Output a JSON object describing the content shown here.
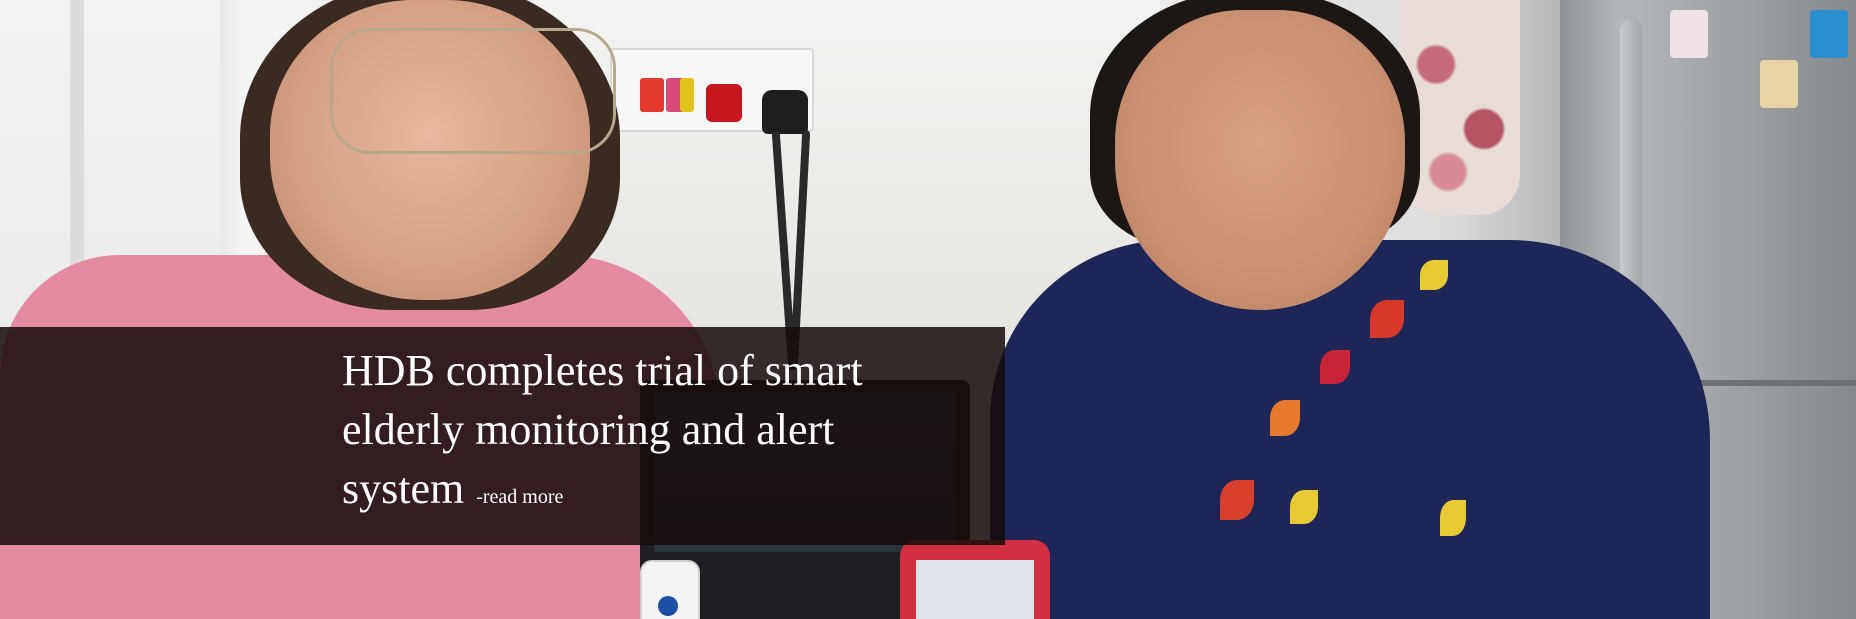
{
  "banner": {
    "headline": "HDB completes trial of smart elderly monitoring and alert system",
    "read_more_label": "-read more"
  },
  "colors": {
    "overlay": "#160c0a",
    "caption_text": "#ffffff",
    "left_shirt": "#e48aa1",
    "right_shirt": "#1d2657",
    "phone": "#d23040"
  }
}
